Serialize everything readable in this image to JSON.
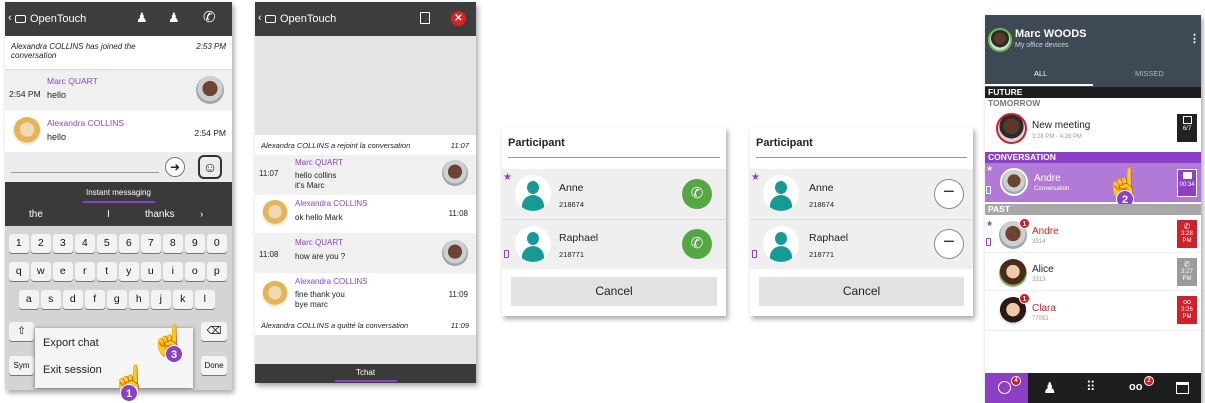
{
  "app_name": "OpenTouch",
  "panel1": {
    "joined_text": "Alexandra COLLINS has joined the conversation",
    "joined_time": "2:53 PM",
    "msg1": {
      "time": "2:54 PM",
      "name": "Marc QUART",
      "text": "hello"
    },
    "msg2": {
      "name": "Alexandra COLLINS",
      "text": "hello",
      "time": "2:54 PM"
    },
    "im_label": "Instant messaging",
    "suggestions": [
      "the",
      "I",
      "thanks"
    ],
    "row_numbers": [
      "1",
      "2",
      "3",
      "4",
      "5",
      "6",
      "7",
      "8",
      "9",
      "0"
    ],
    "row_q": [
      "q",
      "w",
      "e",
      "r",
      "t",
      "y",
      "u",
      "i",
      "o",
      "p"
    ],
    "row_a": [
      "a",
      "s",
      "d",
      "f",
      "g",
      "h",
      "j",
      "k",
      "l"
    ],
    "sym_label": "Sym",
    "done_label": "Done",
    "menu_export": "Export chat",
    "menu_exit": "Exit session",
    "step1": "1",
    "step3": "3"
  },
  "panel2": {
    "joined_text": "Alexandra COLLINS a rejoint la conversation",
    "joined_time": "11:07",
    "m1": {
      "time": "11:07",
      "name": "Marc QUART",
      "line1": "hello collins",
      "line2": "it's Marc"
    },
    "m2": {
      "name": "Alexandra COLLINS",
      "text": "ok hello Mark",
      "time": "11:08"
    },
    "m3": {
      "time": "11:08",
      "name": "Marc QUART",
      "text": "how are you ?"
    },
    "m4": {
      "name": "Alexandra COLLINS",
      "line1": "fine thank you",
      "line2": "bye marc",
      "time": "11:09"
    },
    "left_text": "Alexandra COLLINS a quitté la conversation",
    "left_time": "11:09",
    "tab_label": "Tchat"
  },
  "dialog": {
    "title": "Participant",
    "p1": {
      "name": "Anne",
      "number": "218674"
    },
    "p2": {
      "name": "Raphael",
      "number": "218771"
    },
    "cancel": "Cancel"
  },
  "panel5": {
    "user_name": "Marc WOODS",
    "user_sub": "My office devices",
    "tab_all": "ALL",
    "tab_missed": "MISSED",
    "future": "FUTURE",
    "tomorrow": "TOMORROW",
    "meeting": {
      "title": "New meeting",
      "time": "3:28 PM - 4:28 PM",
      "date": "6/7"
    },
    "conversation": "CONVERSATION",
    "andre_conv": {
      "name": "Andre",
      "sub": "Conversation",
      "time": "00:34"
    },
    "past": "PAST",
    "andre": {
      "name": "Andre",
      "number": "3314",
      "time": "3:28 PM",
      "badge": "1"
    },
    "alice": {
      "name": "Alice",
      "number": "3313",
      "time": "3:27 PM"
    },
    "clara": {
      "name": "Clara",
      "number": "77051",
      "time": "3:26 PM",
      "badge": "1"
    },
    "step2": "2",
    "nav_badge_history": "4",
    "nav_badge_voicemail": "2"
  },
  "colors": {
    "purple": "#8d3fc5",
    "call_green": "#55a744",
    "dark_bar": "#3d3d3d",
    "missed_red": "#d0202a"
  }
}
